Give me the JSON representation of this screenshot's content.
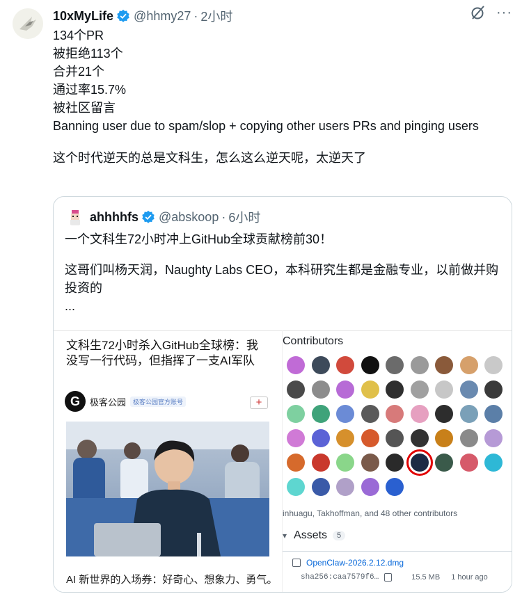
{
  "tweet": {
    "author": "10xMyLife",
    "handle": "@hhmy27",
    "dot": "·",
    "time": "2小时",
    "lines": [
      "134个PR",
      "被拒绝113个",
      "合并21个",
      "通过率15.7%",
      "被社区留言",
      "Banning user due to spam/slop + copying other users PRs and pinging users"
    ],
    "closing": "这个时代逆天的总是文科生，怎么这么逆天呢，太逆天了",
    "more_icon": "···"
  },
  "quote": {
    "author": "ahhhhfs",
    "handle": "@abskoop",
    "dot": "·",
    "time": "6小时",
    "line1": "一个文科生72小时冲上GitHub全球贡献榜前30！",
    "line2": "这哥们叫杨天润，Naughty Labs CEO，本科研究生都是金融专业，以前做并购投资的",
    "ellipsis": "..."
  },
  "media_left": {
    "title": "文科生72小时杀入GitHub全球榜：我没写一行代码，但指挥了一支AI军队",
    "logo_letter": "G",
    "source": "极客公园",
    "badge": "极客公园官方账号",
    "plus": "+",
    "caption": "AI 新世界的入场券：好奇心、想象力、勇气。"
  },
  "media_right": {
    "title": "Contributors",
    "contributors_text": "inhuagu, Takhoffman, and 48 other contributors",
    "assets_label": "Assets",
    "assets_count": "5",
    "chevron": "▾",
    "file_name": "OpenClaw-2026.2.12.dmg",
    "sha": "sha256:caa7579f6…",
    "size": "15.5 MB",
    "age": "1 hour ago"
  },
  "colors": {
    "verified": "#1d9bf0",
    "muted": "#536471",
    "highlight": "#e10000",
    "link": "#0969da"
  },
  "icons": [
    "verified-badge-icon",
    "grok-icon",
    "more-icon",
    "package-icon",
    "copy-icon"
  ]
}
